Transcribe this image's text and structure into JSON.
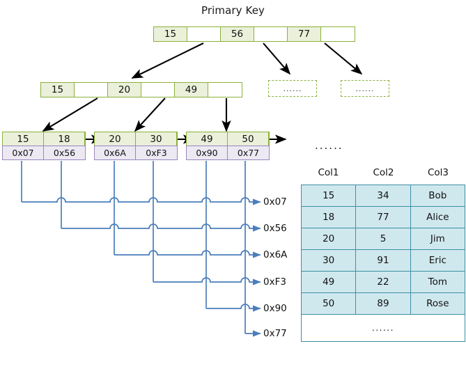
{
  "title": "Primary Key",
  "tree": {
    "root": {
      "cells": [
        {
          "label": "15",
          "empty": false
        },
        {
          "label": "",
          "empty": true
        },
        {
          "label": "56",
          "empty": false
        },
        {
          "label": "",
          "empty": true
        },
        {
          "label": "77",
          "empty": false
        },
        {
          "label": "",
          "empty": true
        }
      ]
    },
    "internal": {
      "cells": [
        {
          "label": "15",
          "empty": false
        },
        {
          "label": "",
          "empty": true
        },
        {
          "label": "20",
          "empty": false
        },
        {
          "label": "",
          "empty": true
        },
        {
          "label": "49",
          "empty": false
        },
        {
          "label": "",
          "empty": true
        }
      ]
    },
    "leaves": [
      {
        "keys": [
          "15",
          "18"
        ],
        "pointers": [
          "0x07",
          "0x56"
        ]
      },
      {
        "keys": [
          "20",
          "30"
        ],
        "pointers": [
          "0x6A",
          "0xF3"
        ]
      },
      {
        "keys": [
          "49",
          "50"
        ],
        "pointers": [
          "0x90",
          "0x77"
        ]
      }
    ],
    "placeholders": [
      {
        "label": "......"
      },
      {
        "label": "......"
      }
    ],
    "leaf_overflow_label": "......"
  },
  "pointer_targets": [
    {
      "label": "0x07"
    },
    {
      "label": "0x56"
    },
    {
      "label": "0x6A"
    },
    {
      "label": "0xF3"
    },
    {
      "label": "0x90"
    },
    {
      "label": "0x77"
    }
  ],
  "table": {
    "headers": [
      "Col1",
      "Col2",
      "Col3"
    ],
    "rows": [
      [
        "15",
        "34",
        "Bob"
      ],
      [
        "18",
        "77",
        "Alice"
      ],
      [
        "20",
        "5",
        "Jim"
      ],
      [
        "30",
        "91",
        "Eric"
      ],
      [
        "49",
        "22",
        "Tom"
      ],
      [
        "50",
        "89",
        "Rose"
      ]
    ],
    "more_label": "......"
  },
  "colors": {
    "index_border": "#8bb03a",
    "index_fill": "#eaf0da",
    "pointer_border": "#9a86bd",
    "pointer_fill": "#ece9f3",
    "table_border": "#3d8fa3",
    "table_fill": "#cfe8ee",
    "connector": "#4a7ebb",
    "arrow": "#000000"
  }
}
